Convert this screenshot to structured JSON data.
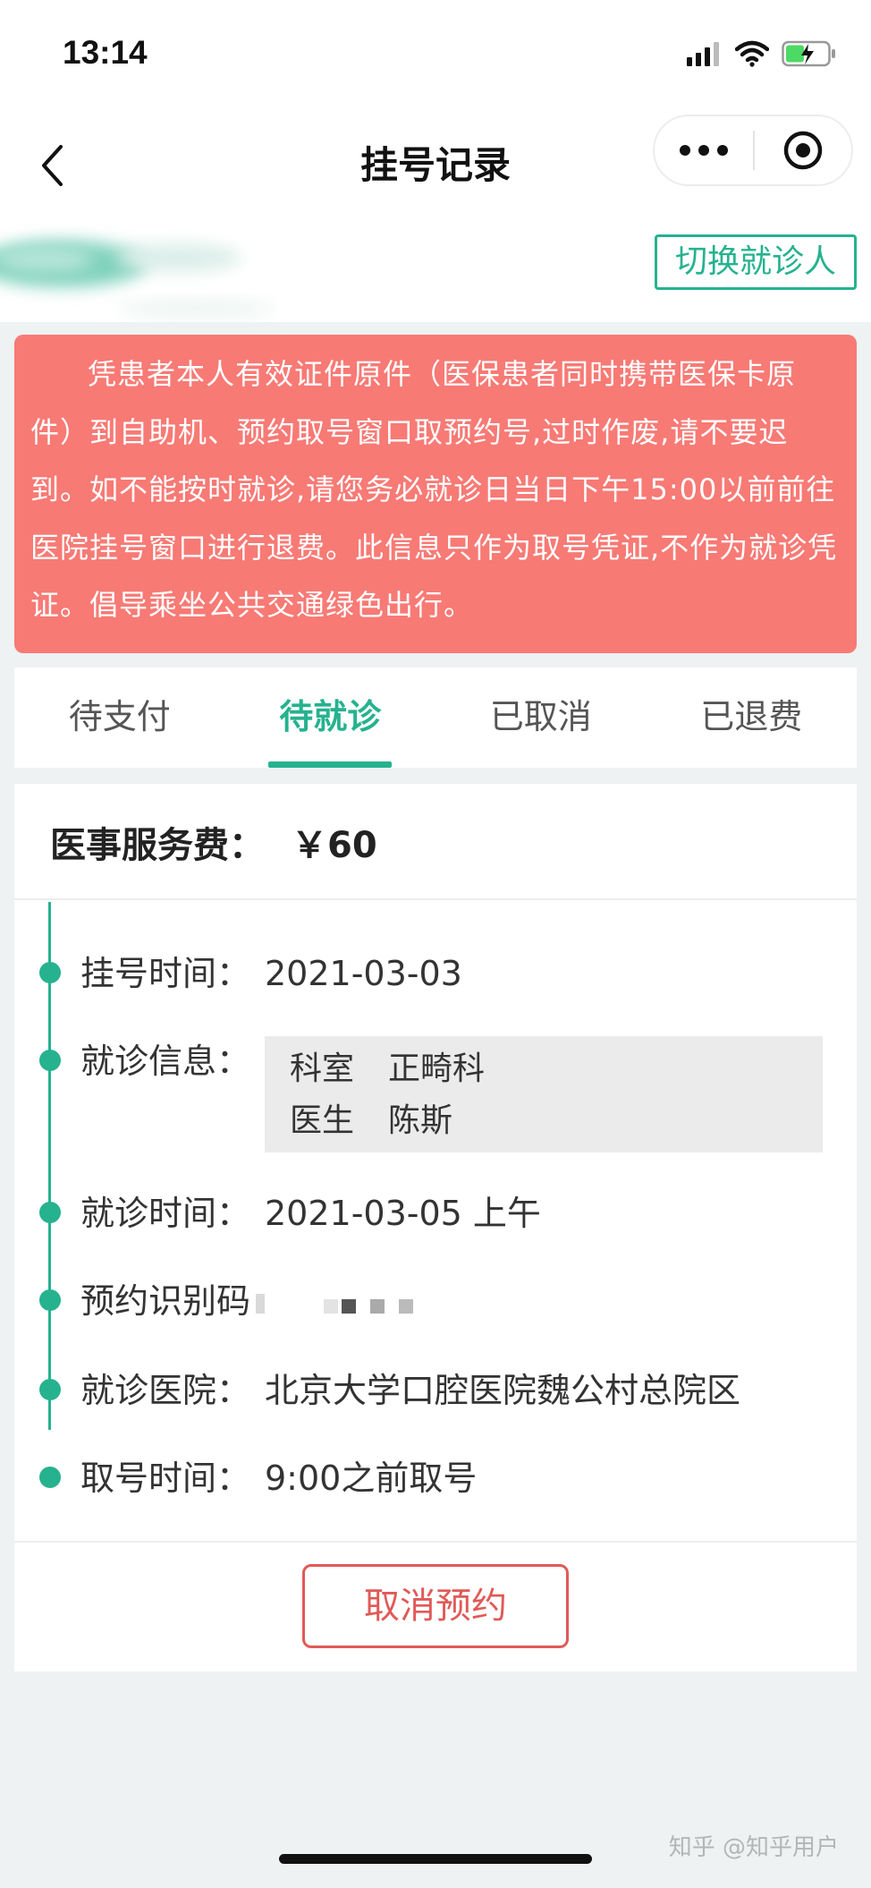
{
  "status_bar": {
    "time": "13:14",
    "icons": [
      "signal-icon",
      "wifi-icon",
      "battery-charging-icon"
    ]
  },
  "nav": {
    "title": "挂号记录",
    "back_icon": "chevron-left-icon",
    "more_icon": "more-dots-icon",
    "close_icon": "target-circle-icon"
  },
  "patient": {
    "switch_label": "切换就诊人"
  },
  "notice": {
    "text": "凭患者本人有效证件原件（医保患者同时携带医保卡原件）到自助机、预约取号窗口取预约号,过时作废,请不要迟到。如不能按时就诊,请您务必就诊日当日下午15:00以前前往医院挂号窗口进行退费。此信息只作为取号凭证,不作为就诊凭证。倡导乘坐公共交通绿色出行。"
  },
  "tabs": [
    {
      "label": "待支付",
      "active": false
    },
    {
      "label": "待就诊",
      "active": true
    },
    {
      "label": "已取消",
      "active": false
    },
    {
      "label": "已退费",
      "active": false
    }
  ],
  "record": {
    "fee_label": "医事服务费：",
    "fee_value": "￥60",
    "register_time_label": "挂号时间：",
    "register_time": "2021-03-03",
    "visit_info_label": "就诊信息：",
    "visit_info": [
      {
        "key": "科室",
        "value": "正畸科"
      },
      {
        "key": "医生",
        "value": "陈斯"
      }
    ],
    "visit_time_label": "就诊时间：",
    "visit_time": "2021-03-05 上午",
    "code_label": "预约识别码",
    "hospital_label": "就诊医院：",
    "hospital": "北京大学口腔医院魏公村总院区",
    "pickup_time_label": "取号时间：",
    "pickup_time": "9:00之前取号"
  },
  "actions": {
    "cancel_label": "取消预约"
  },
  "watermark": "知乎 @知乎用户",
  "colors": {
    "accent": "#26b28f",
    "notice_bg": "#f77a75",
    "danger": "#e05a58",
    "page_bg": "#eef2f3"
  }
}
